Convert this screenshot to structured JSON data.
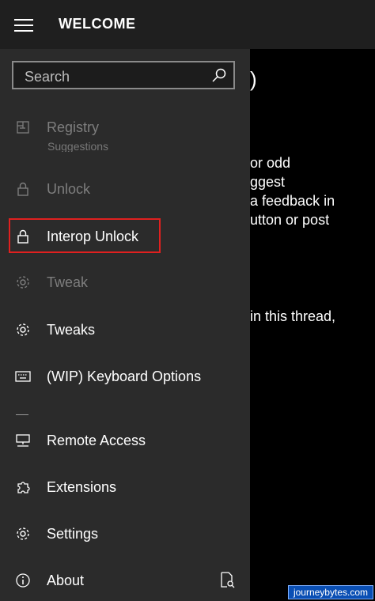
{
  "header": {
    "title": "WELCOME"
  },
  "search": {
    "placeholder": "Search"
  },
  "content_lines": [
    ")",
    " or odd",
    "ggest",
    "a feedback in",
    "utton or post",
    "in this thread,"
  ],
  "nav": {
    "registry": "Registry",
    "ghost_text": "Suggestions",
    "unlock": "Unlock",
    "interop_unlock": "Interop Unlock",
    "tweak": "Tweak",
    "tweaks": "Tweaks",
    "keyboard": "(WIP) Keyboard Options",
    "remote": "Remote Access",
    "extensions": "Extensions",
    "settings": "Settings",
    "about": "About"
  },
  "watermark": "journeybytes.com",
  "colors": {
    "pane": "#2b2b2b",
    "highlight": "#e0201f",
    "dim": "#7e7e7e"
  }
}
